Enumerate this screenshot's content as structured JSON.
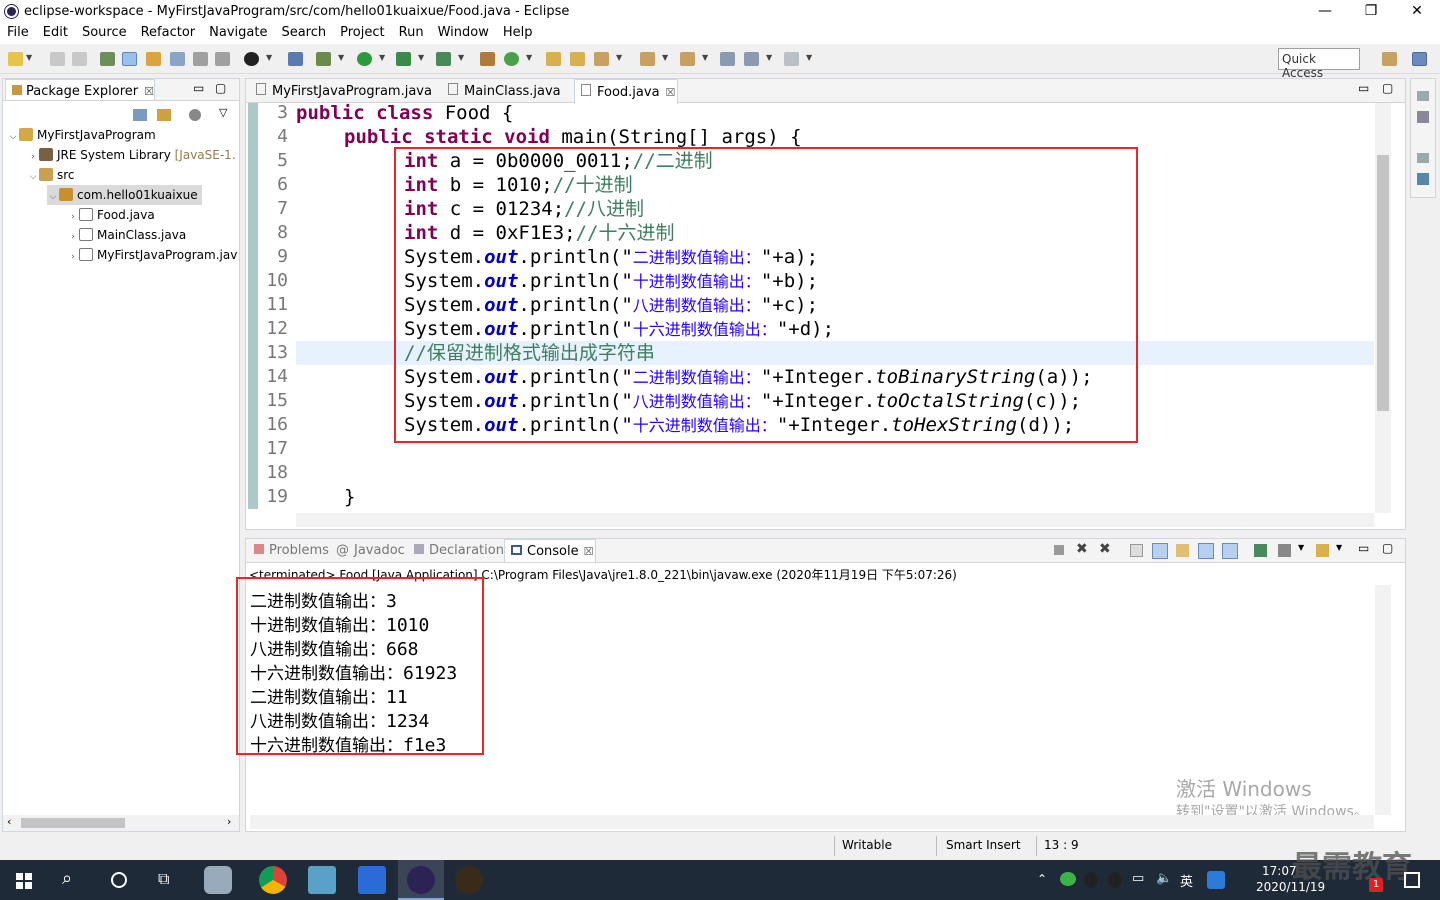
{
  "window": {
    "title": "eclipse-workspace - MyFirstJavaProgram/src/com/hello01kuaixue/Food.java - Eclipse",
    "minimize": "—",
    "maximize": "❐",
    "close": "✕"
  },
  "menu": [
    "File",
    "Edit",
    "Source",
    "Refactor",
    "Navigate",
    "Search",
    "Project",
    "Run",
    "Window",
    "Help"
  ],
  "toolbar": {
    "quick_access": "Quick Access"
  },
  "package_explorer": {
    "tab_label": "Package Explorer",
    "tree": [
      {
        "label": "MyFirstJavaProgram",
        "extra": ""
      },
      {
        "label": "JRE System Library",
        "extra": "[JavaSE-1."
      },
      {
        "label": "src",
        "extra": ""
      },
      {
        "label": "com.hello01kuaixue",
        "extra": ""
      },
      {
        "label": "Food.java",
        "extra": ""
      },
      {
        "label": "MainClass.java",
        "extra": ""
      },
      {
        "label": "MyFirstJavaProgram.jav",
        "extra": ""
      }
    ]
  },
  "editor": {
    "tabs": [
      "MyFirstJavaProgram.java",
      "MainClass.java",
      "Food.java"
    ],
    "line_numbers": [
      "3",
      "4",
      "5",
      "6",
      "7",
      "8",
      "9",
      "10",
      "11",
      "12",
      "13",
      "14",
      "15",
      "16",
      "17",
      "18",
      "19"
    ],
    "code": {
      "l3_kw": "public class ",
      "l3_rest": "Food {",
      "l4_kw": "public static void ",
      "l4_rest": "main(String[] args) {",
      "int": "int",
      "l5_rest": " a = 0b0000_0011;",
      "l5_cmt": "//二进制",
      "l6_rest": " b = 1010;",
      "l6_cmt": "//十进制",
      "l7_rest": " c = 01234;",
      "l7_cmt": "//八进制",
      "l8_rest": " d = 0xF1E3;",
      "l8_cmt": "//十六进制",
      "sys": "System.",
      "out": "out",
      "println": ".println(\"",
      "s_bin": "二进制数值输出：",
      "s_dec": "十进制数值输出：",
      "s_oct": "八进制数值输出：",
      "s_hex": "十六进制数值输出：",
      "end_a": "\"+a);",
      "end_b": "\"+b);",
      "end_c": "\"+c);",
      "end_d": "\"+d);",
      "l13_cmt": "//保留进制格式输出成字符串",
      "int_cls": "\"+Integer.",
      "m_bin": "toBinaryString",
      "m_oct": "toOctalString",
      "m_hex": "toHexString",
      "arg_a": "(a));",
      "arg_c": "(c));",
      "arg_d": "(d));",
      "l19": "}"
    }
  },
  "bottom_panel": {
    "tabs": [
      "Problems",
      "Javadoc",
      "Declaration",
      "Console"
    ],
    "terminated": "<terminated> Food [Java Application] C:\\Program Files\\Java\\jre1.8.0_221\\bin\\javaw.exe (2020年11月19日 下午5:07:26)",
    "output": [
      {
        "label": "二进制数值输出：",
        "value": "3"
      },
      {
        "label": "十进制数值输出：",
        "value": "1010"
      },
      {
        "label": "八进制数值输出：",
        "value": "668"
      },
      {
        "label": "十六进制数值输出：",
        "value": "61923"
      },
      {
        "label": "二进制数值输出：",
        "value": "11"
      },
      {
        "label": "八进制数值输出：",
        "value": "1234"
      },
      {
        "label": "十六进制数值输出：",
        "value": "f1e3"
      }
    ],
    "watermark_line1": "激活 Windows",
    "watermark_line2": "转到\"设置\"以激活 Windows。"
  },
  "status": {
    "writable": "Writable",
    "insert": "Smart Insert",
    "position": "13 : 9"
  },
  "taskbar": {
    "time": "17:07",
    "date": "2020/11/19",
    "lang": "英",
    "brand": "最需教育",
    "badge": "1"
  },
  "colors": {
    "red_box": "#e8272a",
    "keyword": "#7f0055",
    "string": "#2a00ff",
    "comment": "#3f7f5f",
    "field": "#0000c0"
  }
}
